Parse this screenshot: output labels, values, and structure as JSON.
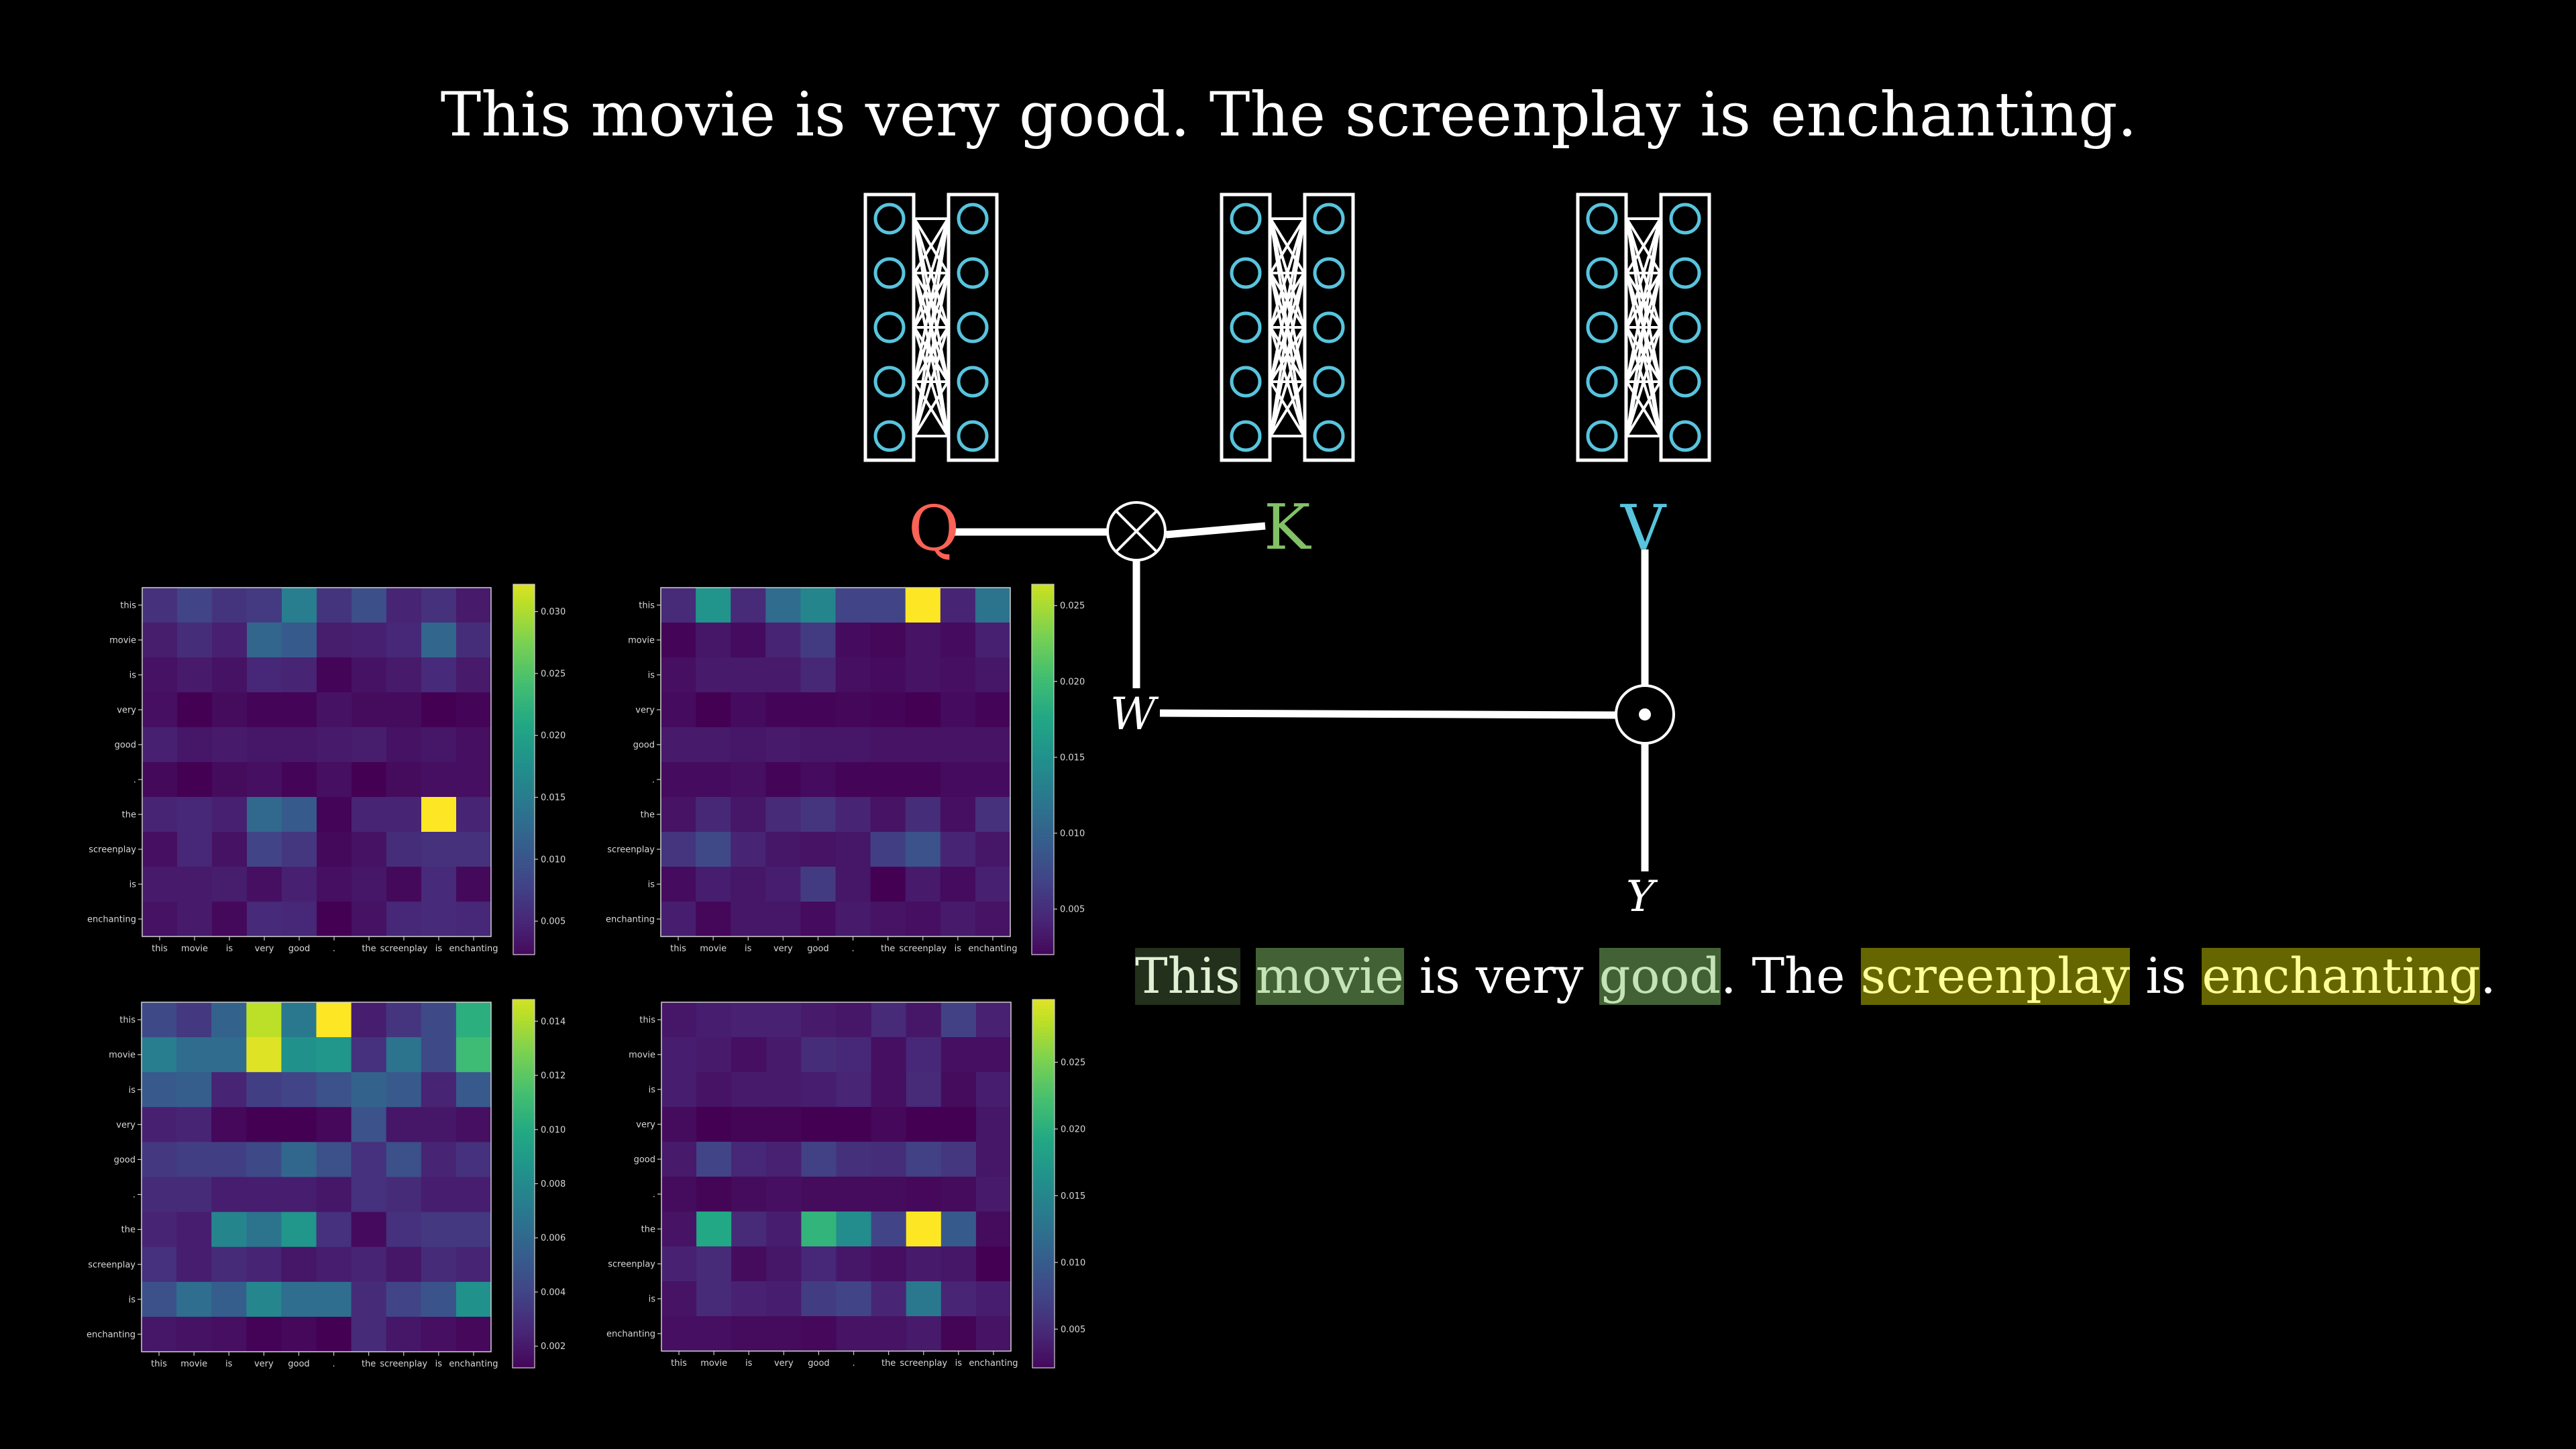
{
  "title": "This movie is very good. The screenplay is enchanting.",
  "colors": {
    "background": "#000000",
    "query": "#fc6255",
    "key": "#83c167",
    "value": "#58c4dd",
    "neuron": "#58c4dd",
    "line": "#ffffff"
  },
  "diagram": {
    "networks": [
      {
        "name": "query-network",
        "neurons_per_layer": 5,
        "layers": 2
      },
      {
        "name": "key-network",
        "neurons_per_layer": 5,
        "layers": 2
      },
      {
        "name": "value-network",
        "neurons_per_layer": 5,
        "layers": 2
      }
    ],
    "labels": {
      "q": "Q",
      "k": "K",
      "v": "V",
      "w": "W",
      "y": "Y"
    },
    "operators": {
      "qk": "tensor-product",
      "wv": "dot-product"
    }
  },
  "highlighted_sentence": [
    {
      "text": "This",
      "bg": "#22301c",
      "fg": "#dff0d4"
    },
    {
      "text": " "
    },
    {
      "text": "movie",
      "bg": "#426236",
      "fg": "#c5e3b5"
    },
    {
      "text": " is very "
    },
    {
      "text": "good",
      "bg": "#426236",
      "fg": "#c5e3b5"
    },
    {
      "text": ". The "
    },
    {
      "text": "screenplay",
      "bg": "#666600",
      "fg": "#ffff99"
    },
    {
      "text": " is "
    },
    {
      "text": "enchanting",
      "bg": "#666600",
      "fg": "#ffff99"
    },
    {
      "text": "."
    }
  ],
  "chart_data": [
    {
      "type": "heatmap",
      "title": "",
      "xlabel": "",
      "ylabel": "",
      "colormap": "viridis",
      "x_tick_labels": [
        "this",
        "movie",
        "is",
        "very",
        "good",
        ".",
        "the",
        "screenplay",
        "is",
        "enchanting"
      ],
      "y_tick_labels": [
        "this",
        "movie",
        "is",
        "very",
        "good",
        ".",
        "the",
        "screenplay",
        "is",
        "enchanting"
      ],
      "vmin": 0.0015,
      "vmax": 0.034,
      "colorbar": {
        "range": [
          0.0023,
          0.0322
        ],
        "ticks": [
          0.005,
          0.01,
          0.015,
          0.02,
          0.025,
          0.03
        ],
        "tick_labels": [
          "0.005",
          "0.010",
          "0.015",
          "0.020",
          "0.025",
          "0.030"
        ]
      },
      "values": [
        [
          0.0061,
          0.008,
          0.0064,
          0.007,
          0.0152,
          0.0064,
          0.0093,
          0.0048,
          0.0061,
          0.0038
        ],
        [
          0.0041,
          0.0057,
          0.0044,
          0.0122,
          0.0106,
          0.0041,
          0.0044,
          0.0051,
          0.0122,
          0.0057
        ],
        [
          0.0031,
          0.0038,
          0.0031,
          0.0051,
          0.0048,
          0.0018,
          0.0031,
          0.0038,
          0.0054,
          0.0038
        ],
        [
          0.0028,
          0.0015,
          0.0025,
          0.0018,
          0.0018,
          0.0031,
          0.0025,
          0.0025,
          0.0015,
          0.0018
        ],
        [
          0.0044,
          0.0035,
          0.0038,
          0.0035,
          0.0035,
          0.0038,
          0.0041,
          0.0031,
          0.0035,
          0.0028
        ],
        [
          0.0022,
          0.0015,
          0.0025,
          0.0028,
          0.0018,
          0.0028,
          0.0015,
          0.0025,
          0.0028,
          0.0028
        ],
        [
          0.0048,
          0.0051,
          0.0044,
          0.0126,
          0.0106,
          0.0018,
          0.0048,
          0.0048,
          0.034,
          0.0048
        ],
        [
          0.0028,
          0.0051,
          0.0031,
          0.008,
          0.0067,
          0.0022,
          0.0031,
          0.0057,
          0.0061,
          0.0061
        ],
        [
          0.0038,
          0.0038,
          0.0041,
          0.0028,
          0.0044,
          0.0028,
          0.0035,
          0.0022,
          0.0054,
          0.0022
        ],
        [
          0.0031,
          0.0038,
          0.0022,
          0.0054,
          0.0051,
          0.0015,
          0.0031,
          0.0051,
          0.0054,
          0.0051
        ]
      ]
    },
    {
      "type": "heatmap",
      "title": "",
      "xlabel": "",
      "ylabel": "",
      "colormap": "viridis",
      "x_tick_labels": [
        "this",
        "movie",
        "is",
        "very",
        "good",
        ".",
        "the",
        "screenplay",
        "is",
        "enchanting"
      ],
      "y_tick_labels": [
        "this",
        "movie",
        "is",
        "very",
        "good",
        ".",
        "the",
        "screenplay",
        "is",
        "enchanting"
      ],
      "vmin": 0.0015,
      "vmax": 0.0285,
      "colorbar": {
        "range": [
          0.002,
          0.0264
        ],
        "ticks": [
          0.005,
          0.01,
          0.015,
          0.02,
          0.025
        ],
        "tick_labels": [
          "0.005",
          "0.010",
          "0.015",
          "0.020",
          "0.025"
        ]
      },
      "values": [
        [
          0.0047,
          0.0155,
          0.0047,
          0.011,
          0.0137,
          0.0069,
          0.0069,
          0.0285,
          0.0042,
          0.0118
        ],
        [
          0.0018,
          0.0031,
          0.0023,
          0.0042,
          0.0061,
          0.0023,
          0.002,
          0.0029,
          0.0023,
          0.0039
        ],
        [
          0.0026,
          0.0034,
          0.0034,
          0.0034,
          0.0045,
          0.0026,
          0.0023,
          0.0029,
          0.0026,
          0.0031
        ],
        [
          0.0023,
          0.0015,
          0.0023,
          0.0018,
          0.0018,
          0.002,
          0.0018,
          0.0015,
          0.0023,
          0.0018
        ],
        [
          0.0034,
          0.0034,
          0.0031,
          0.0034,
          0.0031,
          0.0031,
          0.0029,
          0.0029,
          0.0029,
          0.0029
        ],
        [
          0.0023,
          0.0023,
          0.0026,
          0.0018,
          0.0023,
          0.0018,
          0.0018,
          0.0018,
          0.0023,
          0.0023
        ],
        [
          0.0029,
          0.0045,
          0.0031,
          0.0047,
          0.0056,
          0.0042,
          0.0029,
          0.005,
          0.0026,
          0.0053
        ],
        [
          0.0056,
          0.0074,
          0.0042,
          0.0031,
          0.0029,
          0.0031,
          0.0064,
          0.0083,
          0.0042,
          0.0031
        ],
        [
          0.0023,
          0.0037,
          0.0031,
          0.0037,
          0.0061,
          0.0031,
          0.0015,
          0.0034,
          0.0023,
          0.0039
        ],
        [
          0.0037,
          0.002,
          0.0031,
          0.0031,
          0.0023,
          0.0034,
          0.0029,
          0.0026,
          0.0034,
          0.0029
        ]
      ]
    },
    {
      "type": "heatmap",
      "title": "",
      "xlabel": "",
      "ylabel": "",
      "colormap": "viridis",
      "x_tick_labels": [
        "this",
        "movie",
        "is",
        "very",
        "good",
        ".",
        "the",
        "screenplay",
        "is",
        "enchanting"
      ],
      "y_tick_labels": [
        "this",
        "movie",
        "is",
        "very",
        "good",
        ".",
        "the",
        "screenplay",
        "is",
        "enchanting"
      ],
      "vmin": 0.001,
      "vmax": 0.0158,
      "colorbar": {
        "range": [
          0.0012,
          0.0148
        ],
        "ticks": [
          0.002,
          0.004,
          0.006,
          0.008,
          0.01,
          0.012,
          0.014
        ],
        "tick_labels": [
          "0.002",
          "0.004",
          "0.006",
          "0.008",
          "0.010",
          "0.012",
          "0.014"
        ]
      },
      "values": [
        [
          0.0043,
          0.0034,
          0.0057,
          0.0143,
          0.0069,
          0.0158,
          0.0022,
          0.0032,
          0.0043,
          0.0103
        ],
        [
          0.0072,
          0.0062,
          0.0062,
          0.0151,
          0.0084,
          0.0087,
          0.0031,
          0.0066,
          0.0043,
          0.0111
        ],
        [
          0.0051,
          0.0054,
          0.0025,
          0.0037,
          0.004,
          0.0047,
          0.0057,
          0.0051,
          0.0025,
          0.0051
        ],
        [
          0.0023,
          0.0025,
          0.0013,
          0.001,
          0.001,
          0.0013,
          0.0047,
          0.0019,
          0.0019,
          0.0016
        ],
        [
          0.0034,
          0.0037,
          0.0037,
          0.0043,
          0.0059,
          0.0046,
          0.0031,
          0.0046,
          0.0025,
          0.0031
        ],
        [
          0.0028,
          0.0028,
          0.0022,
          0.0022,
          0.0022,
          0.0019,
          0.0031,
          0.0028,
          0.0022,
          0.0022
        ],
        [
          0.0025,
          0.0022,
          0.0077,
          0.0066,
          0.0087,
          0.0031,
          0.0014,
          0.0031,
          0.0034,
          0.0034
        ],
        [
          0.0031,
          0.0022,
          0.0028,
          0.0025,
          0.0019,
          0.0022,
          0.0025,
          0.0019,
          0.0028,
          0.0025
        ],
        [
          0.0046,
          0.0063,
          0.0054,
          0.0078,
          0.0063,
          0.0063,
          0.0028,
          0.004,
          0.0048,
          0.0084
        ],
        [
          0.0019,
          0.0017,
          0.0016,
          0.0011,
          0.0013,
          0.001,
          0.0028,
          0.0019,
          0.0016,
          0.0013
        ]
      ]
    },
    {
      "type": "heatmap",
      "title": "",
      "xlabel": "",
      "ylabel": "",
      "colormap": "viridis",
      "x_tick_labels": [
        "this",
        "movie",
        "is",
        "very",
        "good",
        ".",
        "the",
        "screenplay",
        "is",
        "enchanting"
      ],
      "y_tick_labels": [
        "this",
        "movie",
        "is",
        "very",
        "good",
        ".",
        "the",
        "screenplay",
        "is",
        "enchanting"
      ],
      "vmin": 0.0015,
      "vmax": 0.031,
      "colorbar": {
        "range": [
          0.0021,
          0.0297
        ],
        "ticks": [
          0.005,
          0.01,
          0.015,
          0.02,
          0.025
        ],
        "tick_labels": [
          "0.005",
          "0.010",
          "0.015",
          "0.020",
          "0.025"
        ]
      },
      "values": [
        [
          0.0033,
          0.0039,
          0.0042,
          0.0042,
          0.0036,
          0.0033,
          0.005,
          0.0033,
          0.0071,
          0.0042
        ],
        [
          0.0039,
          0.0036,
          0.0027,
          0.0036,
          0.0053,
          0.0047,
          0.0027,
          0.0047,
          0.0027,
          0.0027
        ],
        [
          0.0039,
          0.003,
          0.0036,
          0.0036,
          0.0039,
          0.0045,
          0.0027,
          0.005,
          0.0024,
          0.0039
        ],
        [
          0.0024,
          0.0015,
          0.0018,
          0.0018,
          0.0015,
          0.0015,
          0.0021,
          0.0015,
          0.0015,
          0.0033
        ],
        [
          0.0036,
          0.0074,
          0.0047,
          0.0042,
          0.0071,
          0.0056,
          0.0053,
          0.0071,
          0.0062,
          0.0033
        ],
        [
          0.0024,
          0.0018,
          0.0024,
          0.0027,
          0.0024,
          0.0024,
          0.0024,
          0.0021,
          0.0024,
          0.0036
        ],
        [
          0.003,
          0.0192,
          0.005,
          0.0039,
          0.0207,
          0.0157,
          0.0074,
          0.031,
          0.0098,
          0.0024
        ],
        [
          0.0042,
          0.005,
          0.0024,
          0.0033,
          0.0047,
          0.0033,
          0.0027,
          0.0036,
          0.0033,
          0.0015
        ],
        [
          0.003,
          0.005,
          0.0042,
          0.0039,
          0.0068,
          0.0074,
          0.0045,
          0.0133,
          0.0045,
          0.0039
        ],
        [
          0.0027,
          0.0027,
          0.0024,
          0.0024,
          0.0021,
          0.003,
          0.003,
          0.0036,
          0.0018,
          0.003
        ]
      ]
    }
  ]
}
